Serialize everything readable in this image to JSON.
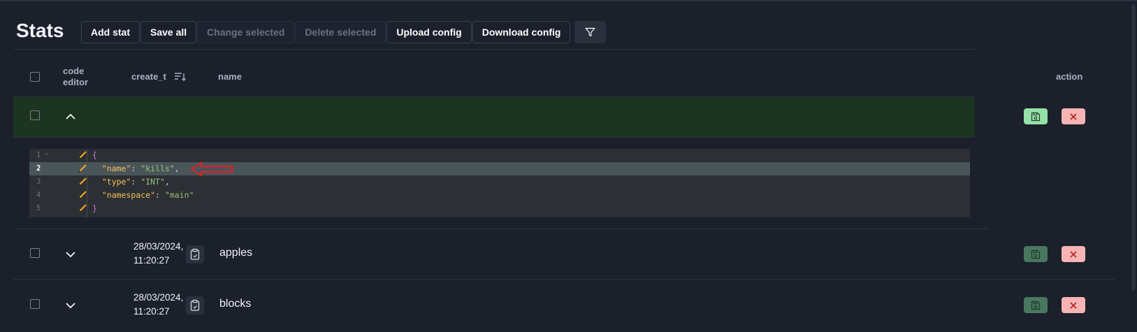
{
  "page": {
    "title": "Stats"
  },
  "toolbar": {
    "add_stat": "Add stat",
    "save_all": "Save all",
    "change_selected": "Change selected",
    "delete_selected": "Delete selected",
    "upload_config": "Upload config",
    "download_config": "Download config"
  },
  "table": {
    "headers": {
      "code_editor_line1": "code",
      "code_editor_line2": "editor",
      "create_t": "create_t",
      "name": "name",
      "action": "action"
    },
    "rows": [
      {
        "date_line1": "28/03/2024,",
        "date_line2": "11:20:27",
        "name": "apples"
      },
      {
        "date_line1": "28/03/2024,",
        "date_line2": "11:20:27",
        "name": "blocks"
      }
    ]
  },
  "editor": {
    "line_numbers": [
      "1",
      "2",
      "3",
      "4",
      "5"
    ],
    "current_line": 2,
    "lines": {
      "l1_brace": "{",
      "l2_key": "\"name\"",
      "l2_sep": ": ",
      "l2_val": "\"kills\"",
      "l2_end": ",",
      "l3_key": "\"type\"",
      "l3_sep": ": ",
      "l3_val": "\"INT\"",
      "l3_end": ",",
      "l4_key": "\"namespace\"",
      "l4_sep": ": ",
      "l4_val": "\"main\"",
      "l5_brace": "}"
    }
  },
  "colors": {
    "background": "#1b202b",
    "expanded_row": "#1c3520",
    "save_active": "#95e2a8",
    "save_dim": "#497760",
    "delete": "#f6b4b4",
    "annotation_arrow": "#e0202a"
  },
  "icons": [
    "filter-icon",
    "sort-icon",
    "chevron-up-icon",
    "chevron-down-icon",
    "pencil-icon",
    "clipboard-icon",
    "save-icon",
    "close-icon",
    "red-arrow-annotation"
  ]
}
